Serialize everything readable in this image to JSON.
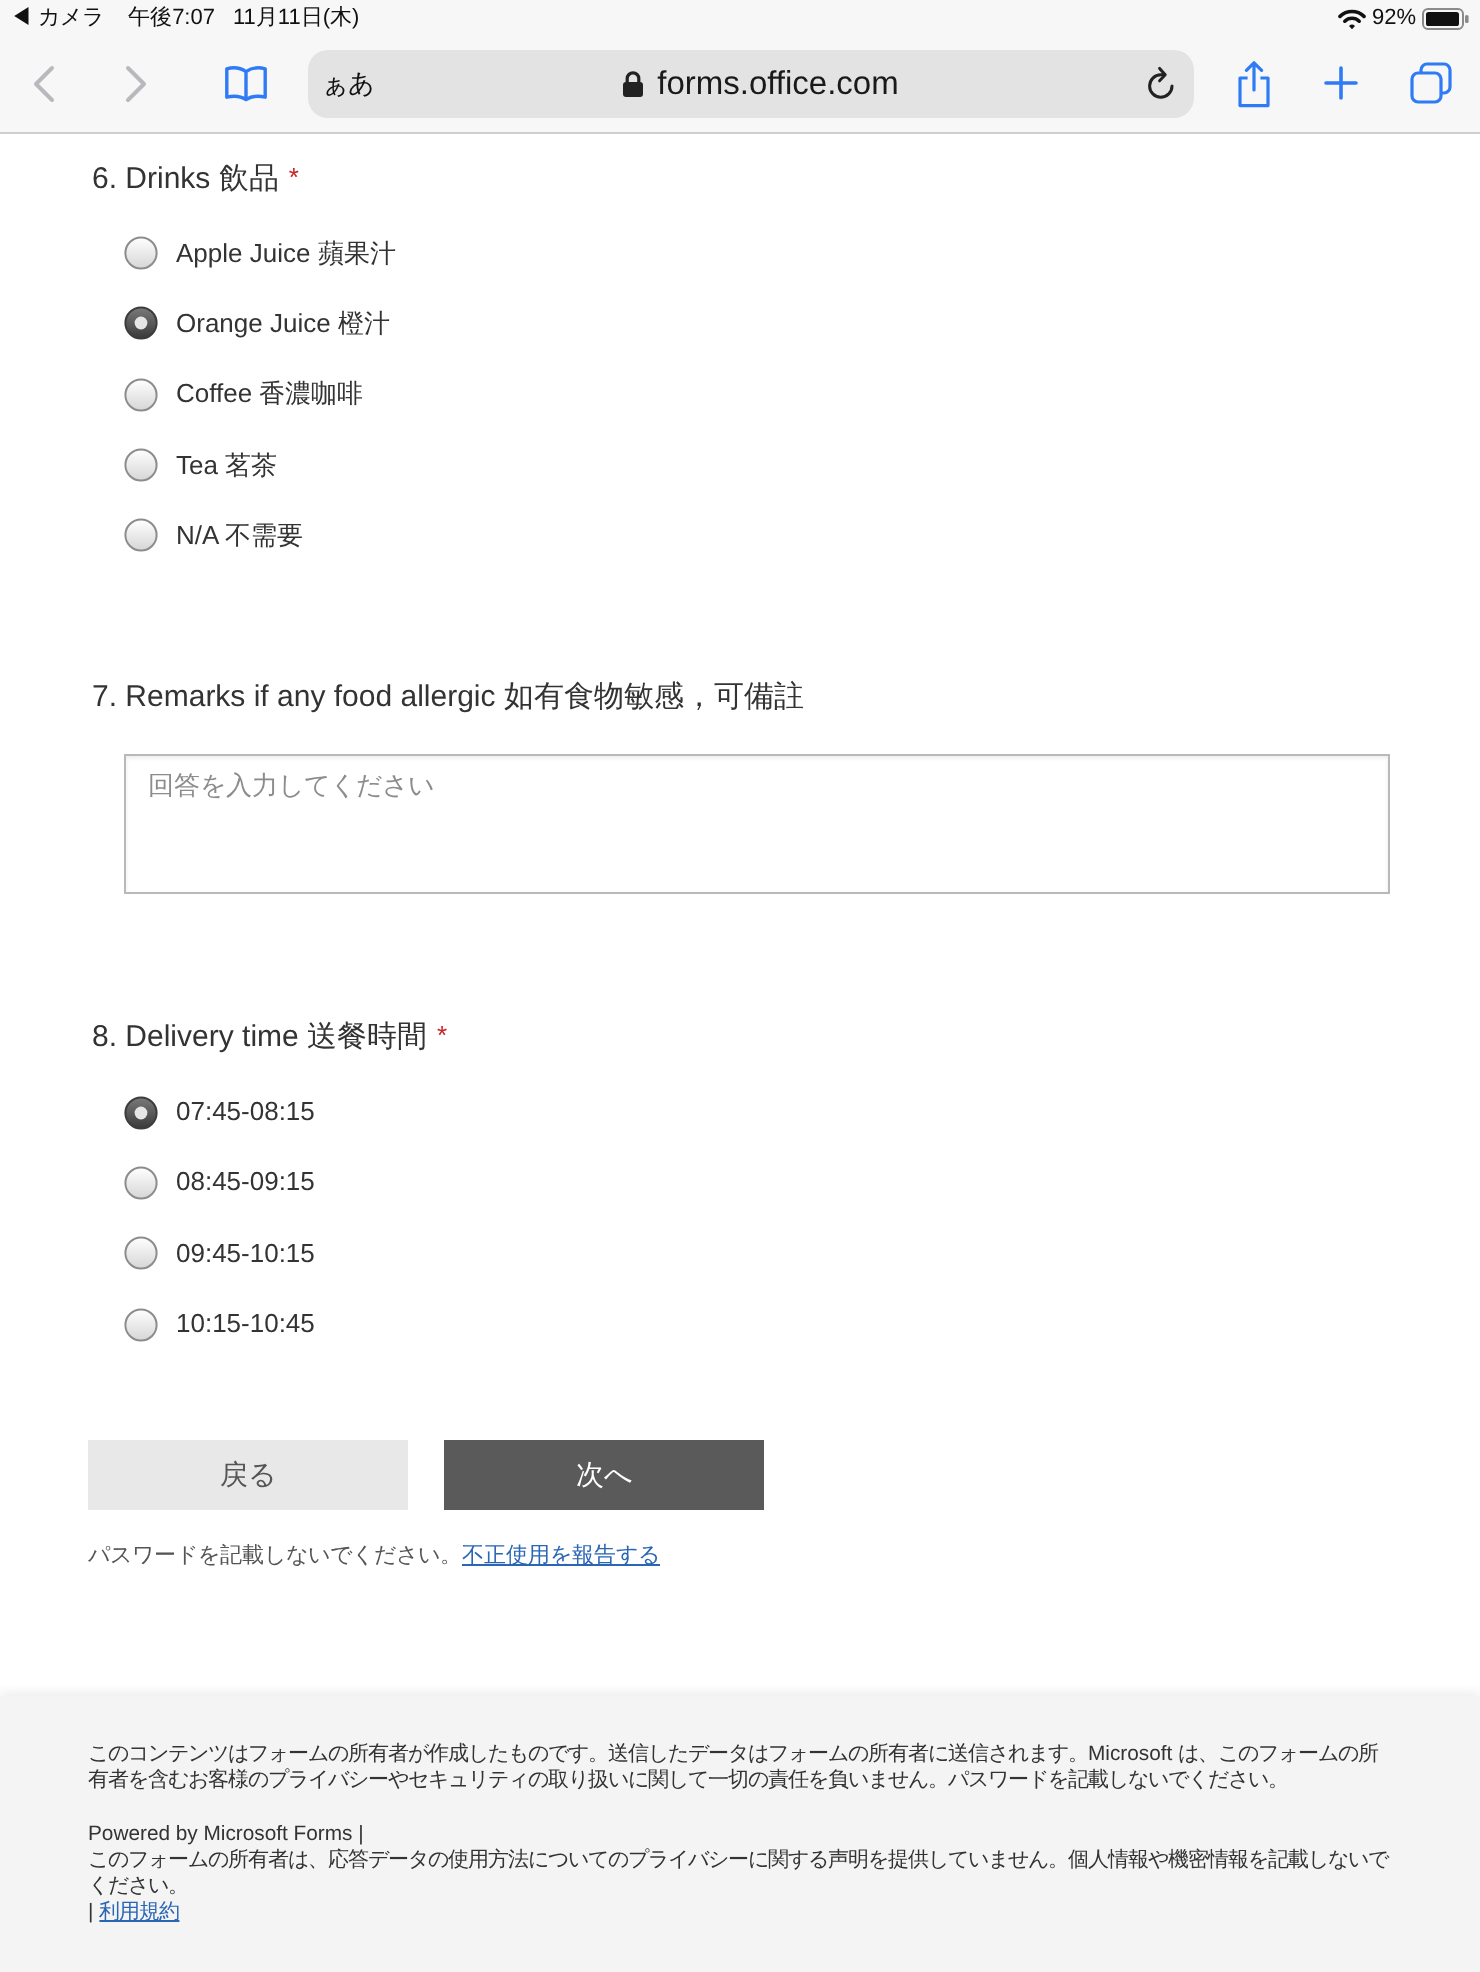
{
  "status_bar": {
    "back_to_app": "◀ カメラ",
    "time": "午後7:07",
    "date": "11月11日(木)",
    "battery": "92%"
  },
  "browser_toolbar": {
    "nav_buttons": [
      {
        "kind": "back",
        "disabled": true
      },
      {
        "kind": "forward",
        "disabled": true
      }
    ],
    "text_size_button": "ぁあ",
    "url": "forms.office.com"
  },
  "questions": [
    {
      "kind": "choice",
      "title": "6. Drinks 飲品",
      "required_mark": "*",
      "options": [
        {
          "label": "Apple Juice 蘋果汁",
          "selected": false
        },
        {
          "label": "Orange Juice 橙汁",
          "selected": true
        },
        {
          "label": "Coffee 香濃咖啡",
          "selected": false
        },
        {
          "label": "Tea 茗茶",
          "selected": false
        },
        {
          "label": "N/A 不需要",
          "selected": false
        }
      ]
    },
    {
      "kind": "text",
      "title": "7. Remarks if any food allergic 如有食物敏感，可備註",
      "placeholder": "回答を入力してください"
    },
    {
      "kind": "choice",
      "title": "8. Delivery time 送餐時間",
      "required_mark": "*",
      "options": [
        {
          "label": "07:45-08:15",
          "selected": true
        },
        {
          "label": "08:45-09:15",
          "selected": false
        },
        {
          "label": "09:45-10:15",
          "selected": false
        },
        {
          "label": "10:15-10:45",
          "selected": false
        }
      ]
    }
  ],
  "buttons": [
    {
      "kind": "secondary",
      "label": "戻る"
    },
    {
      "kind": "primary",
      "label": "次へ"
    }
  ],
  "notice": {
    "text": "パスワードを記載しないでください。",
    "link": "不正使用を報告する"
  },
  "footer": {
    "disclaimer": "このコンテンツはフォームの所有者が作成したものです。送信したデータはフォームの所有者に送信されます。Microsoft は、このフォームの所有者を含むお客様のプライバシーやセキュリティの取り扱いに関して一切の責任を負いません。パスワードを記載しないでください。",
    "powered_by": "Powered by Microsoft Forms |",
    "privacy_note": "このフォームの所有者は、応答データの使用方法についてのプライバシーに関する声明を提供していません。個人情報や機密情報を記載しないでください。",
    "separator": "|",
    "terms_link": "利用規約"
  }
}
